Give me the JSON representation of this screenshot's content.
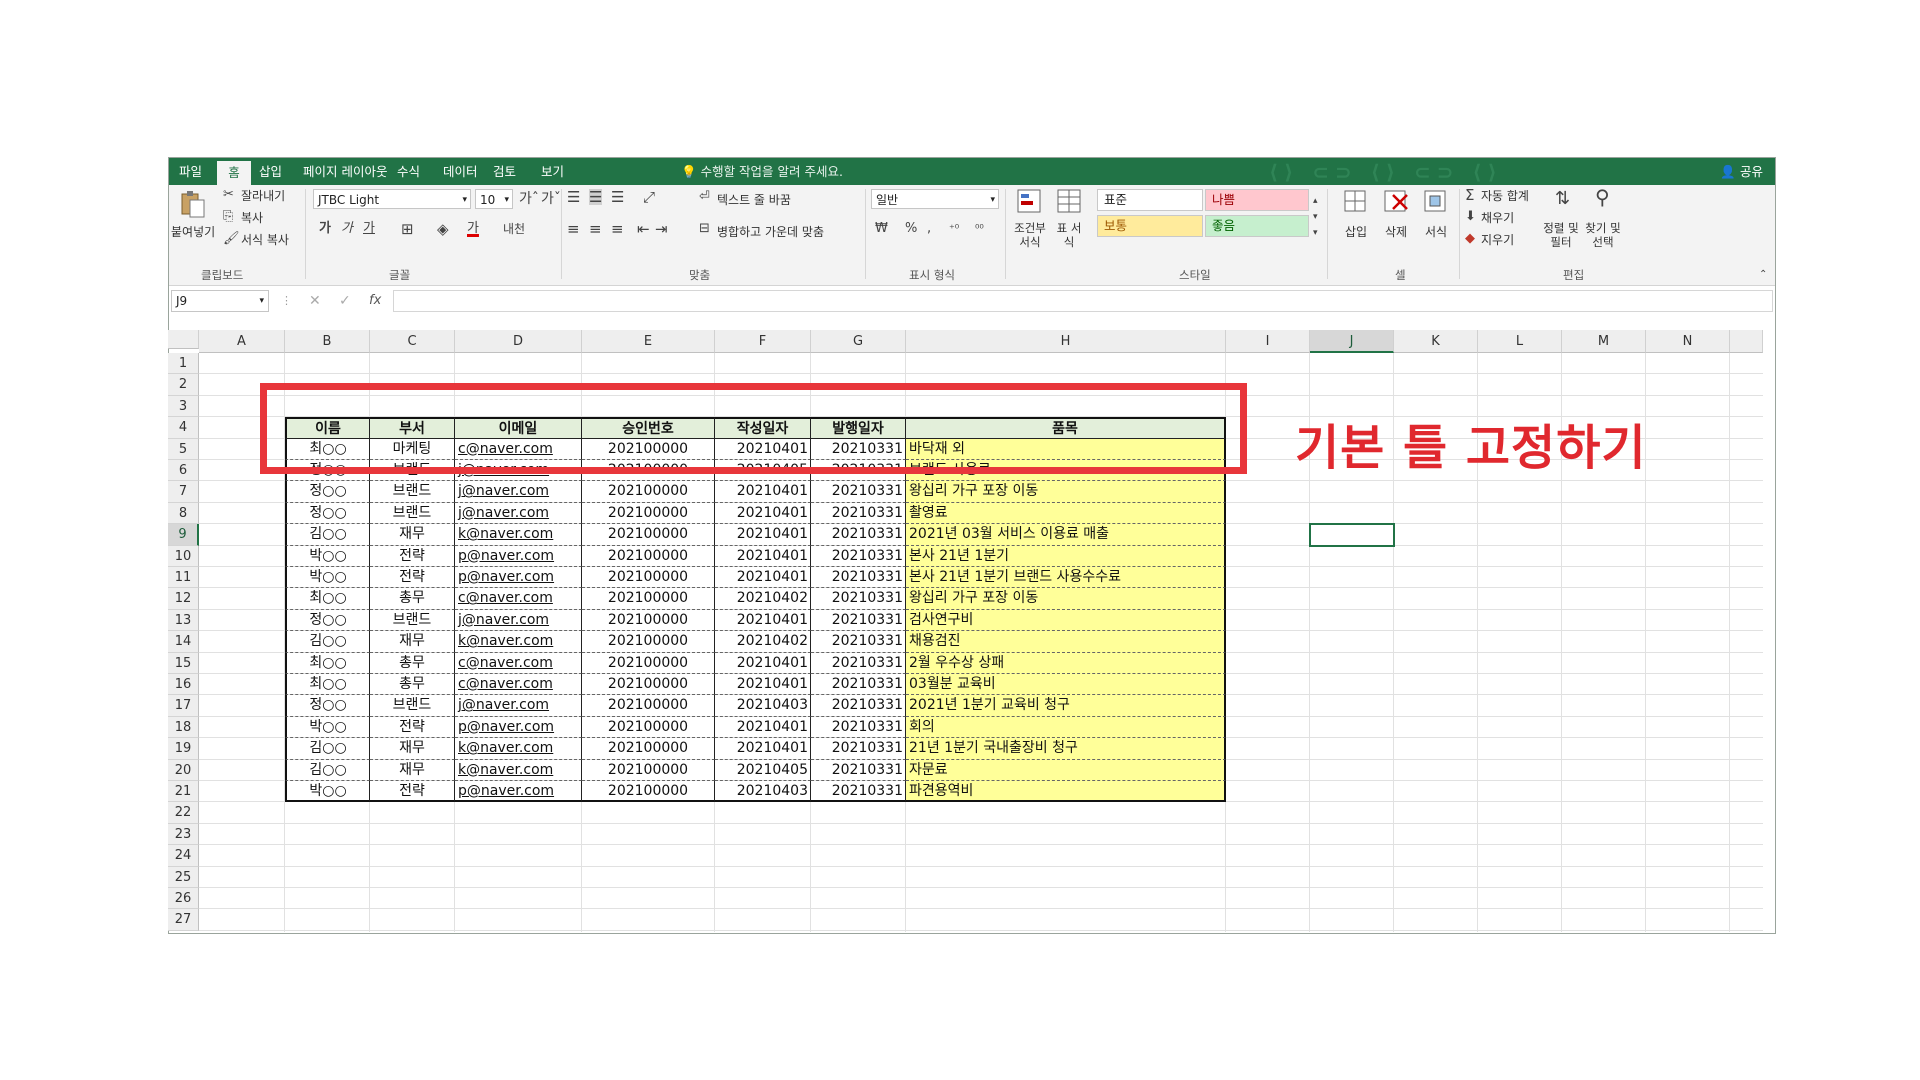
{
  "tabs": [
    {
      "label": "파일"
    },
    {
      "label": "홈"
    },
    {
      "label": "삽입"
    },
    {
      "label": "페이지 레이아웃"
    },
    {
      "label": "수식"
    },
    {
      "label": "데이터"
    },
    {
      "label": "검토"
    },
    {
      "label": "보기"
    }
  ],
  "tell_me": "수행할 작업을 알려 주세요.",
  "share": "공유",
  "ribbon": {
    "clipboard": {
      "paste": "붙여넣기",
      "cut": "잘라내기",
      "copy": "복사",
      "format_painter": "서식 복사",
      "group": "클립보드"
    },
    "font": {
      "name": "JTBC Light",
      "size": "10",
      "group": "글꼴"
    },
    "alignment": {
      "wrap": "텍스트 줄 바꿈",
      "merge": "병합하고 가운데 맞춤",
      "group": "맞춤"
    },
    "number": {
      "format": "일반",
      "group": "표시 형식"
    },
    "styles": {
      "conditional": "조건부 서식",
      "table": "표 서식",
      "normal": "표준",
      "bad": "나쁨",
      "neutral": "보통",
      "good": "좋음",
      "group": "스타일"
    },
    "cells": {
      "insert": "삽입",
      "delete": "삭제",
      "format": "서식",
      "group": "셀"
    },
    "editing": {
      "autosum": "자동 합계",
      "fill": "채우기",
      "clear": "지우기",
      "sort": "정렬 및 필터",
      "find": "찾기 및 선택",
      "group": "편집"
    }
  },
  "name_box": "J9",
  "columns": [
    "A",
    "B",
    "C",
    "D",
    "E",
    "F",
    "G",
    "H",
    "I",
    "J",
    "K",
    "L",
    "M",
    "N"
  ],
  "rows": [
    "1",
    "2",
    "3",
    "4",
    "5",
    "6",
    "7",
    "8",
    "9",
    "10",
    "11",
    "12",
    "13",
    "14",
    "15",
    "16",
    "17",
    "18",
    "19",
    "20",
    "21",
    "22",
    "23",
    "24",
    "25",
    "26",
    "27"
  ],
  "table": {
    "headers": [
      "이름",
      "부서",
      "이메일",
      "승인번호",
      "작성일자",
      "발행일자",
      "품목"
    ],
    "rows": [
      [
        "최○○",
        "마케팅",
        "c@naver.com",
        "202100000",
        "20210401",
        "20210331",
        "바닥재 외"
      ],
      [
        "정○○",
        "브랜드",
        "j@naver.com",
        "202100000",
        "20210405",
        "20210331",
        "브랜드 사용료"
      ],
      [
        "정○○",
        "브랜드",
        "j@naver.com",
        "202100000",
        "20210401",
        "20210331",
        "왕십리 가구 포장 이동"
      ],
      [
        "정○○",
        "브랜드",
        "j@naver.com",
        "202100000",
        "20210401",
        "20210331",
        "촬영료"
      ],
      [
        "김○○",
        "재무",
        "k@naver.com",
        "202100000",
        "20210401",
        "20210331",
        "2021년 03월 서비스 이용료 매출"
      ],
      [
        "박○○",
        "전략",
        "p@naver.com",
        "202100000",
        "20210401",
        "20210331",
        "본사 21년 1분기"
      ],
      [
        "박○○",
        "전략",
        "p@naver.com",
        "202100000",
        "20210401",
        "20210331",
        "본사 21년 1분기 브랜드 사용수수료"
      ],
      [
        "최○○",
        "총무",
        "c@naver.com",
        "202100000",
        "20210402",
        "20210331",
        "왕십리 가구 포장 이동"
      ],
      [
        "정○○",
        "브랜드",
        "j@naver.com",
        "202100000",
        "20210401",
        "20210331",
        "검사연구비"
      ],
      [
        "김○○",
        "재무",
        "k@naver.com",
        "202100000",
        "20210402",
        "20210331",
        "채용검진"
      ],
      [
        "최○○",
        "총무",
        "c@naver.com",
        "202100000",
        "20210401",
        "20210331",
        "2월 우수상 상패"
      ],
      [
        "최○○",
        "총무",
        "c@naver.com",
        "202100000",
        "20210401",
        "20210331",
        "03월분 교육비"
      ],
      [
        "정○○",
        "브랜드",
        "j@naver.com",
        "202100000",
        "20210403",
        "20210331",
        "2021년 1분기 교육비 청구"
      ],
      [
        "박○○",
        "전략",
        "p@naver.com",
        "202100000",
        "20210401",
        "20210331",
        "회의"
      ],
      [
        "김○○",
        "재무",
        "k@naver.com",
        "202100000",
        "20210401",
        "20210331",
        "21년 1분기 국내출장비 청구"
      ],
      [
        "김○○",
        "재무",
        "k@naver.com",
        "202100000",
        "20210405",
        "20210331",
        "자문료"
      ],
      [
        "박○○",
        "전략",
        "p@naver.com",
        "202100000",
        "20210403",
        "20210331",
        "파견용역비"
      ]
    ]
  },
  "annotation": "기본 틀 고정하기",
  "colors": {
    "excel_green": "#217346",
    "header_fill": "#e3efda",
    "item_fill": "#ffff99",
    "highlight_red": "#e8363b"
  }
}
